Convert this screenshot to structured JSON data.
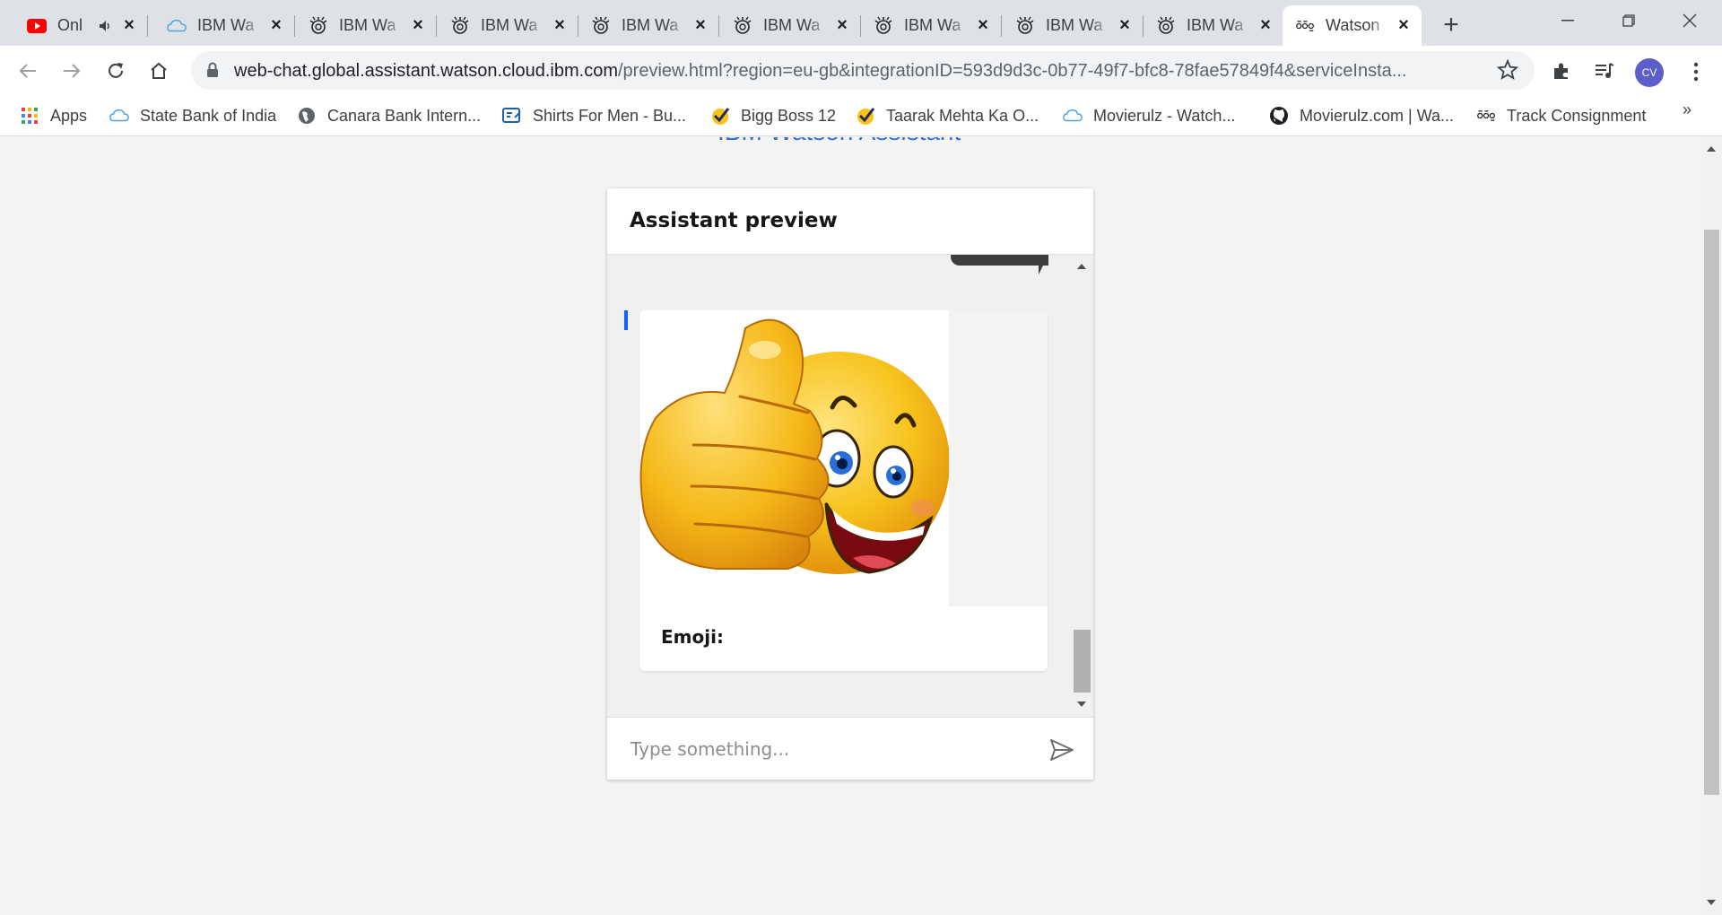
{
  "tabs": [
    {
      "title": "Onl",
      "icon": "youtube-icon",
      "audio": true
    },
    {
      "title": "IBM Wa",
      "icon": "ibm-cloud-icon"
    },
    {
      "title": "IBM Wa",
      "icon": "watson-icon"
    },
    {
      "title": "IBM Wa",
      "icon": "watson-icon"
    },
    {
      "title": "IBM Wa",
      "icon": "watson-icon"
    },
    {
      "title": "IBM Wa",
      "icon": "watson-icon"
    },
    {
      "title": "IBM Wa",
      "icon": "watson-icon"
    },
    {
      "title": "IBM Wa",
      "icon": "watson-icon"
    },
    {
      "title": "IBM Wa",
      "icon": "watson-icon"
    },
    {
      "title": "Watson",
      "icon": "watson-assistant-icon",
      "active": true
    }
  ],
  "toolbar": {
    "url_host": "web-chat.global.assistant.watson.cloud.ibm.com",
    "url_rest": "/preview.html?region=eu-gb&integrationID=593d9d3c-0b77-49f7-bfc8-78fae57849f4&serviceInsta...",
    "profile_initials": "CV"
  },
  "bookmarks": {
    "apps": "Apps",
    "items": [
      "State Bank of India",
      "Canara Bank Intern...",
      "Shirts For Men - Bu...",
      "Bigg Boss 12",
      "Taarak Mehta Ka O...",
      "Movierulz - Watch...",
      "Movierulz.com | Wa...",
      "Track Consignment"
    ],
    "more": "»"
  },
  "page": {
    "heading": "IBM Watson Assistant"
  },
  "chat": {
    "header_title": "Assistant preview",
    "card_caption": "Emoji:",
    "input_placeholder": "Type something..."
  },
  "colors": {
    "accent": "#0f62fe",
    "heading_link": "#2f6fdb",
    "user_bubble": "#3d3d3d",
    "emoji_yellow": "#f7c21b"
  }
}
